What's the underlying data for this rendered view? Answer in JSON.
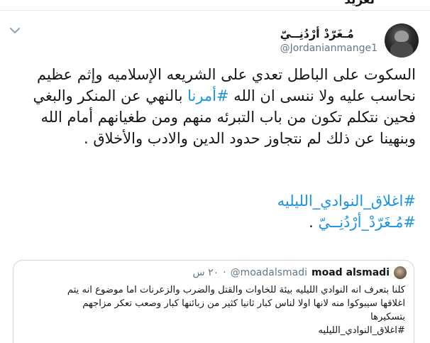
{
  "top_strip": {
    "partial_text": "تغريد"
  },
  "tweet": {
    "author": {
      "display_name": "مُـغَرّدْ أرْدُنِــيّ",
      "handle": "@Jordanianmange1"
    },
    "body": {
      "t1": "السكوت على الباطل تعدي على الشريعه الإسلاميه وإثم عظيم نحاسب عليه ولا ننسى ان الله ",
      "tag1": "#أمرنا",
      "t2": " بالنهي عن المنكر والبغي فحين نتكلم تكون من باب التبرئه منهم ومن طغيانهم أمام الله وبنهينا عن ذلك لم نتجاوز حدود الدين والادب والأخلاق ."
    },
    "tags": {
      "tag2": "#اغلاق_النوادي_الليليه",
      "tag3": "#مُـغَرّدْ_أرْدُنِــيّ",
      "tag3_suffix": " ."
    }
  },
  "quote": {
    "name": "moad alsmadi",
    "handle": "@moadalsmadi",
    "dot": "·",
    "time": "٢٠ س",
    "lines": {
      "l1": "كلنا بتعرف انه النوادي الليليه بيئة للخاوات والقتل والضرب والزعرنات اما موضوع انه يتم",
      "l2": "اغلاقها سيبوكوا منه لانها اولا لناس كبار ثانيا كثير من زبائنها كبار وصعب تعكر مزاجهم",
      "l3": "بتسكيرها",
      "l4": "#اغلاق_النوادي_الليليه"
    }
  },
  "colors": {
    "hashtag": "#1b95e0",
    "text": "#14171a",
    "muted": "#657786",
    "border": "#ccd6dd"
  },
  "icons": {
    "caret": "chevron-down-icon"
  }
}
